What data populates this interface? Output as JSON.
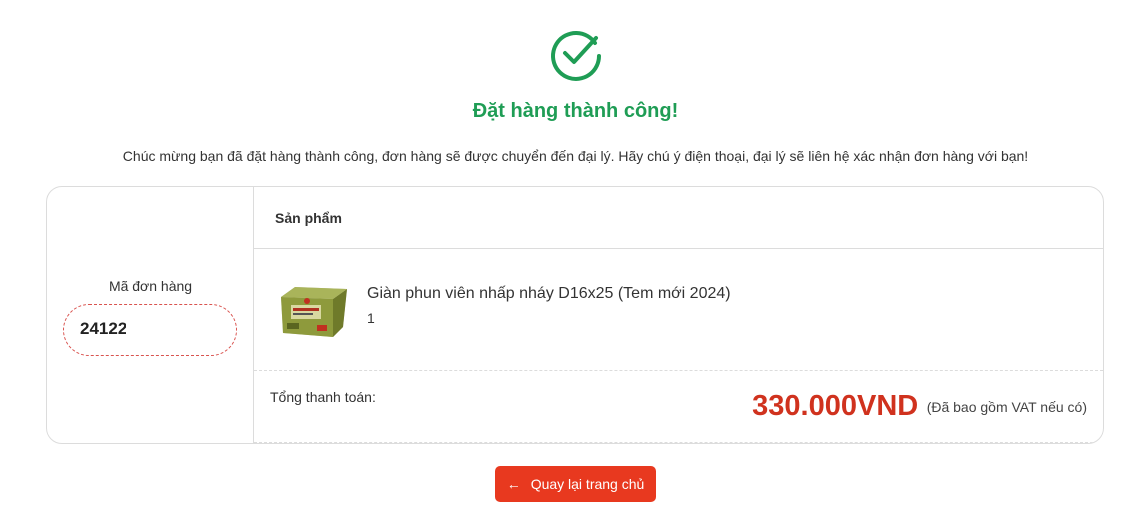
{
  "success": {
    "icon": "check-circle-icon",
    "title": "Đặt hàng thành công!",
    "message": "Chúc mừng bạn đã đặt hàng thành công, đơn hàng sẽ được chuyển đến đại lý. Hãy chú ý điện thoại, đại lý sẽ liên hệ xác nhận đơn hàng với bạn!"
  },
  "order": {
    "code_label": "Mã đơn hàng",
    "code_value": "24122"
  },
  "products": {
    "header": "Sản phẩm",
    "items": [
      {
        "name": "Giàn phun viên nhấp nháy D16x25 (Tem mới 2024)",
        "quantity": "1",
        "image": "product-box-image"
      }
    ]
  },
  "total": {
    "label": "Tổng thanh toán:",
    "amount": "330.000VND",
    "note": "(Đã bao gồm VAT nếu có)"
  },
  "actions": {
    "back_label": "Quay lại trang chủ",
    "back_icon": "arrow-left-icon"
  },
  "colors": {
    "success": "#1f9d55",
    "price": "#d0321e",
    "button": "#e8391f",
    "dashed_border": "#d9534f"
  }
}
